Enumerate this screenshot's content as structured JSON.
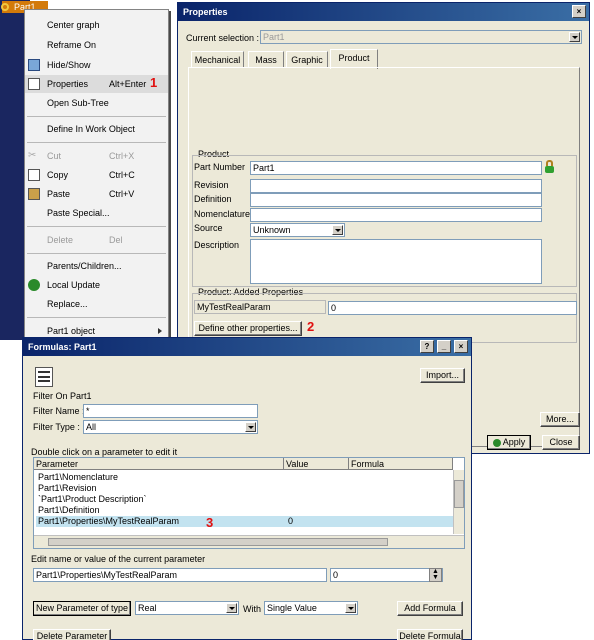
{
  "tree": {
    "label": "Part1"
  },
  "context_menu": {
    "items": [
      {
        "label": "Center graph",
        "shortcut": "",
        "disabled": false
      },
      {
        "label": "Reframe On",
        "shortcut": "",
        "disabled": false
      },
      {
        "label": "Hide/Show",
        "shortcut": "",
        "disabled": false
      },
      {
        "label": "Properties",
        "shortcut": "Alt+Enter",
        "disabled": false
      },
      {
        "label": "Open Sub-Tree",
        "shortcut": "",
        "disabled": false
      },
      {
        "label": "Define In Work Object",
        "shortcut": "",
        "disabled": false
      },
      {
        "label": "Cut",
        "shortcut": "Ctrl+X",
        "disabled": true
      },
      {
        "label": "Copy",
        "shortcut": "Ctrl+C",
        "disabled": false
      },
      {
        "label": "Paste",
        "shortcut": "Ctrl+V",
        "disabled": false
      },
      {
        "label": "Paste Special...",
        "shortcut": "",
        "disabled": false
      },
      {
        "label": "Delete",
        "shortcut": "Del",
        "disabled": true
      },
      {
        "label": "Parents/Children...",
        "shortcut": "",
        "disabled": false
      },
      {
        "label": "Local Update",
        "shortcut": "",
        "disabled": false
      },
      {
        "label": "Replace...",
        "shortcut": "",
        "disabled": false
      },
      {
        "label": "Part1 object",
        "shortcut": "",
        "disabled": false
      }
    ]
  },
  "annotations": {
    "one": "1",
    "two": "2",
    "three": "3"
  },
  "properties": {
    "title": "Properties",
    "current_selection_label": "Current selection :",
    "current_selection_value": "Part1",
    "tabs": [
      "Mechanical",
      "Mass",
      "Graphic",
      "Product"
    ],
    "product_group": "Product",
    "fields": {
      "part_number_label": "Part Number",
      "part_number_value": "Part1",
      "revision_label": "Revision",
      "definition_label": "Definition",
      "nomenclature_label": "Nomenclature",
      "source_label": "Source",
      "source_value": "Unknown",
      "description_label": "Description"
    },
    "added_group": "Product: Added Properties",
    "added_param_name": "MyTestRealParam",
    "added_param_value": "0",
    "define_other_button": "Define other properties...",
    "more_button": "More...",
    "apply_button": "Apply",
    "close_button": "Close"
  },
  "formulas": {
    "title": "Formulas: Part1",
    "import_button": "Import...",
    "filter_on_label": "Filter On Part1",
    "filter_name_label": "Filter Name :",
    "filter_name_value": "*",
    "filter_type_label": "Filter Type :",
    "filter_type_value": "All",
    "double_click_hint": "Double click on a parameter to edit it",
    "columns": [
      "Parameter",
      "Value",
      "Formula"
    ],
    "rows": [
      {
        "parameter": "Part1\\Nomenclature",
        "value": ""
      },
      {
        "parameter": "Part1\\Revision",
        "value": ""
      },
      {
        "parameter": "`Part1\\Product Description`",
        "value": ""
      },
      {
        "parameter": "Part1\\Definition",
        "value": ""
      },
      {
        "parameter": "Part1\\Properties\\MyTestRealParam",
        "value": "0"
      }
    ],
    "edit_label": "Edit name or value of the current parameter",
    "edit_name_value": "Part1\\Properties\\MyTestRealParam",
    "edit_value": "0",
    "new_param_button": "New Parameter of type",
    "type_value": "Real",
    "with_label": "With",
    "with_value": "Single Value",
    "add_formula_button": "Add Formula",
    "delete_param_button": "Delete Parameter",
    "delete_formula_button": "Delete Formula"
  }
}
